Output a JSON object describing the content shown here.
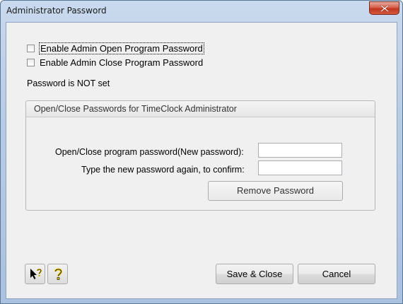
{
  "window": {
    "title": "Administrator Password"
  },
  "options": {
    "enable_open": {
      "label": "Enable Admin Open Program Password",
      "checked": false
    },
    "enable_close": {
      "label": "Enable Admin Close Program Password",
      "checked": false
    }
  },
  "status": "Password is NOT set",
  "group": {
    "title": "Open/Close Passwords for TimeClock Administrator",
    "new_password_label": "Open/Close program password(New password):",
    "new_password_value": "",
    "confirm_label": "Type the new password again, to confirm:",
    "confirm_value": "",
    "remove_label": "Remove Password"
  },
  "footer": {
    "save_label": "Save & Close",
    "cancel_label": "Cancel"
  },
  "icons": {
    "close": "close-icon",
    "context_help": "pointer-help-icon",
    "help": "help-icon"
  }
}
